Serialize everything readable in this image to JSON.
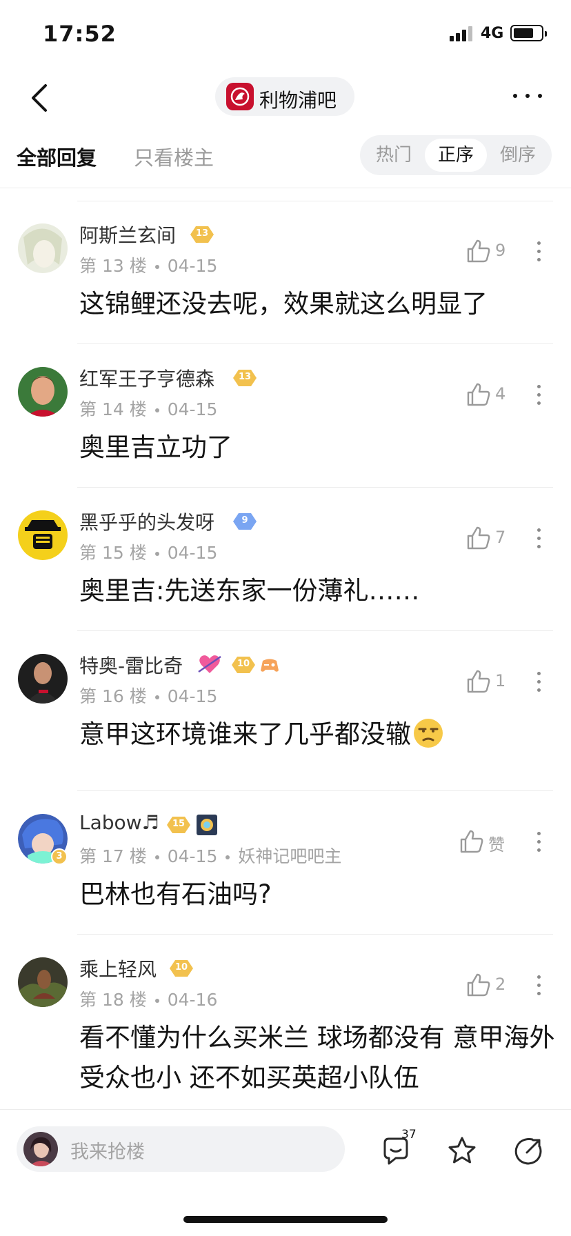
{
  "status_bar": {
    "time": "17:52",
    "network": "4G"
  },
  "header": {
    "forum_name": "利物浦吧",
    "colors": {
      "brand": "#c8102e",
      "pill_bg": "#f1f2f4"
    }
  },
  "tabs": {
    "all_replies": "全部回复",
    "owner_only": "只看楼主",
    "sort": {
      "hot": "热门",
      "asc": "正序",
      "desc": "倒序",
      "selected": "正序"
    }
  },
  "comments": [
    {
      "name": "阿斯兰玄间",
      "level": "13",
      "floor": "第 13 楼",
      "date": "04-15",
      "likes": "9",
      "text": "这锦鲤还没去呢，效果就这么明显了"
    },
    {
      "name": "红军王子亨德森",
      "level": "13",
      "floor": "第 14 楼",
      "date": "04-15",
      "likes": "4",
      "text": "奥里吉立功了"
    },
    {
      "name": "黑乎乎的头发呀",
      "level": "9",
      "floor": "第 15 楼",
      "date": "04-15",
      "likes": "7",
      "text": "奥里吉:先送东家一份薄礼……"
    },
    {
      "name": "特奥-雷比奇",
      "level": "10",
      "floor": "第 16 楼",
      "date": "04-15",
      "likes": "1",
      "text": "意甲这环境谁来了几乎都没辙",
      "emoji": "unamused-face-icon"
    },
    {
      "name": "Labow♬",
      "level": "15",
      "floor": "第 17 楼",
      "date": "04-15",
      "role": "妖神记吧吧主",
      "likes": "赞",
      "avatar_badge": "3",
      "text": "巴林也有石油吗?"
    },
    {
      "name": "乘上轻风",
      "level": "10",
      "floor": "第 18 楼",
      "date": "04-16",
      "likes": "2",
      "text": "看不懂为什么买米兰 球场都没有 意甲海外受众也小 还不如买英超小队伍"
    }
  ],
  "bottom_bar": {
    "reply_placeholder": "我来抢楼",
    "comment_count": "37",
    "icons": [
      "comment-icon",
      "star-icon",
      "share-icon"
    ]
  }
}
